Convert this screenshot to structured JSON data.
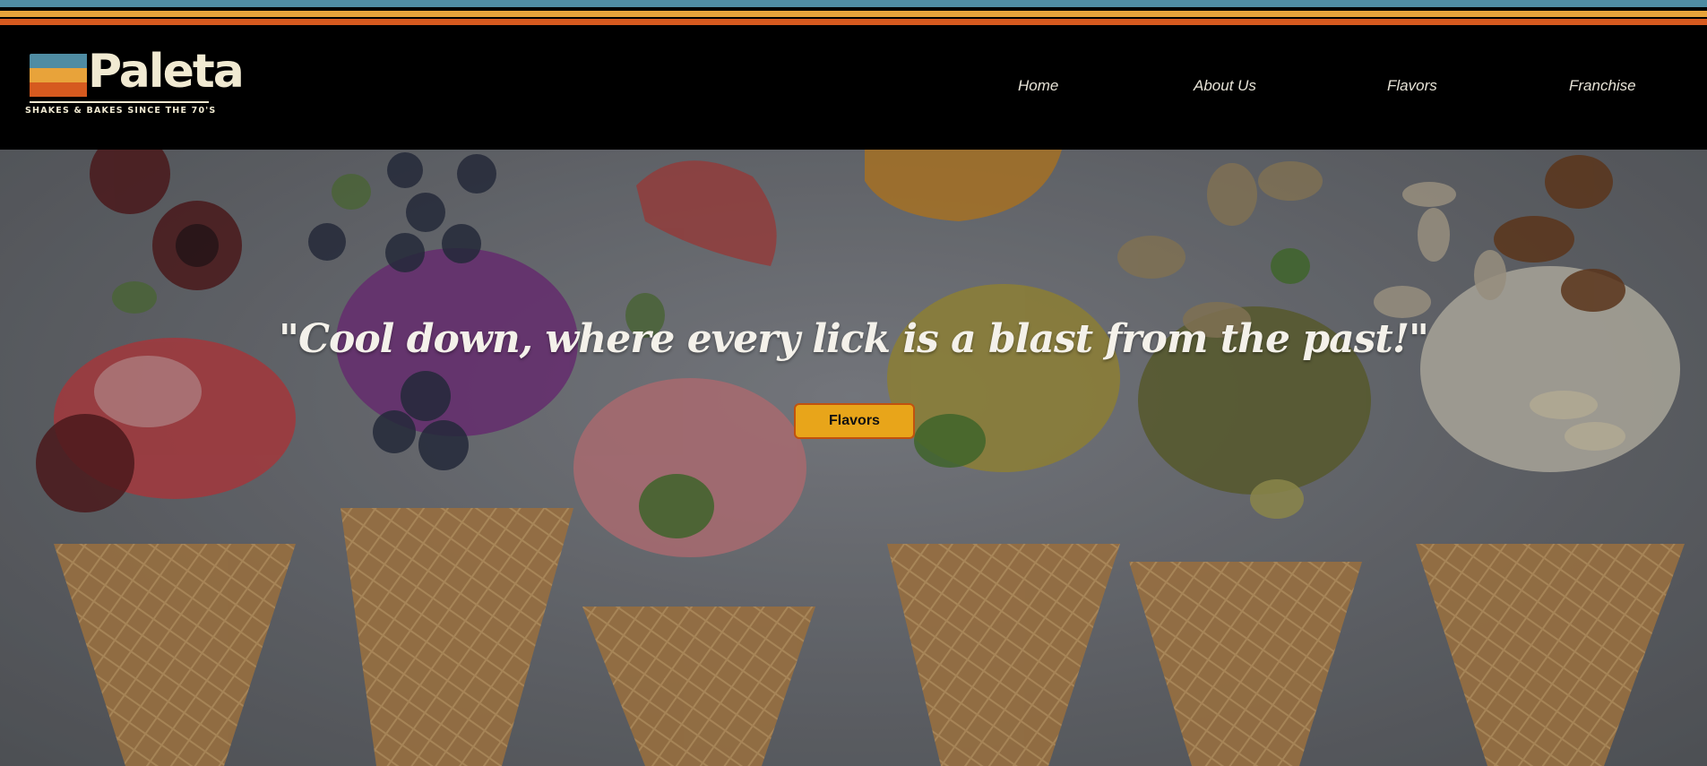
{
  "brand": {
    "name": "Paleta",
    "tagline": "SHAKES & BAKES SINCE THE 70'S",
    "stripe_colors": [
      "#4f8ca3",
      "#e8a33a",
      "#d65a1f"
    ],
    "logo_text_color": "#f1ead2"
  },
  "nav": {
    "items": [
      {
        "label": "Home"
      },
      {
        "label": "About Us"
      },
      {
        "label": "Flavors"
      },
      {
        "label": "Franchise"
      }
    ]
  },
  "hero": {
    "quote": "\"Cool down, where every lick is a blast from  the  past!\"",
    "cta_label": "Flavors",
    "cta_color": "#e8a51a",
    "cta_border_color": "#c0520f",
    "background_image": "ice-cream-cones-with-fruit-and-nuts"
  },
  "colors": {
    "header_bg": "#000000",
    "nav_text": "#e6e2d6",
    "quote_text": "#f4f1ea"
  }
}
